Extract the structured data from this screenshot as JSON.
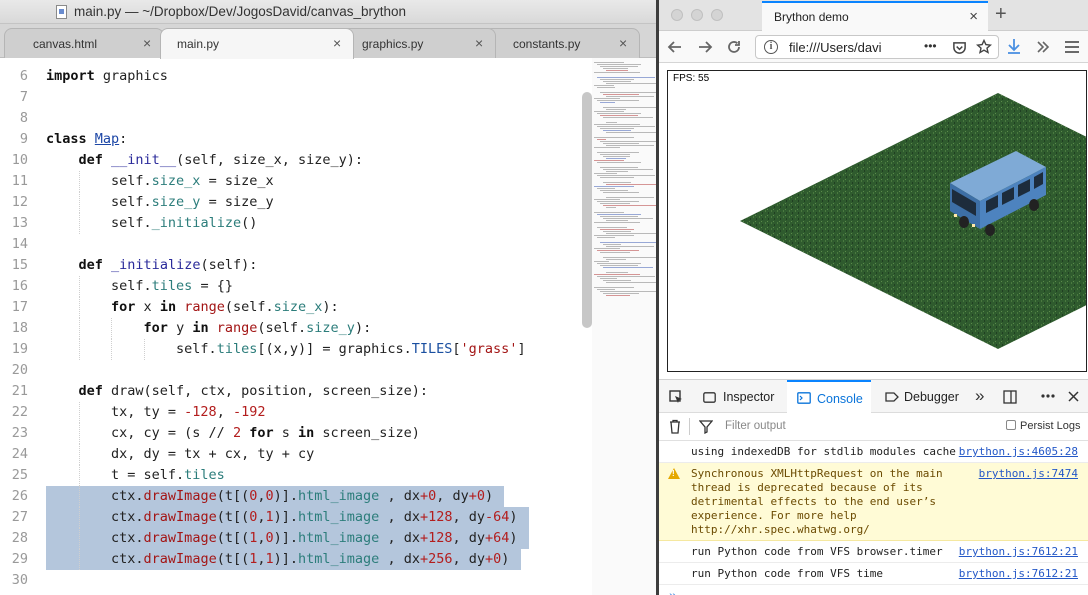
{
  "editor": {
    "window_title": "main.py — ~/Dropbox/Dev/JogosDavid/canvas_brython",
    "tabs": [
      {
        "label": "canvas.html",
        "active": false
      },
      {
        "label": "main.py",
        "active": true
      },
      {
        "label": "graphics.py",
        "active": false
      },
      {
        "label": "constants.py",
        "active": false
      }
    ],
    "tab_close_glyph": "×",
    "line_numbers": [
      "6",
      "7",
      "8",
      "9",
      "10",
      "11",
      "12",
      "13",
      "14",
      "15",
      "16",
      "17",
      "18",
      "19",
      "20",
      "21",
      "22",
      "23",
      "24",
      "25",
      "26",
      "27",
      "28",
      "29",
      "30"
    ],
    "selected_lines": [
      "26",
      "27",
      "28",
      "29"
    ],
    "code_lines": [
      "import graphics",
      "",
      "",
      "class Map:",
      "    def __init__(self, size_x, size_y):",
      "        self.size_x = size_x",
      "        self.size_y = size_y",
      "        self._initialize()",
      "",
      "    def _initialize(self):",
      "        self.tiles = {}",
      "        for x in range(self.size_x):",
      "            for y in range(self.size_y):",
      "                self.tiles[(x,y)] = graphics.TILES['grass']",
      "",
      "    def draw(self, ctx, position, screen_size):",
      "        tx, ty = -128, -192",
      "        cx, cy = (s // 2 for s in screen_size)",
      "        dx, dy = tx + cx, ty + cy",
      "        t = self.tiles",
      "        ctx.drawImage(t[(0,0)].html_image , dx+0, dy+0)",
      "        ctx.drawImage(t[(0,1)].html_image , dx+128, dy-64)",
      "        ctx.drawImage(t[(1,0)].html_image , dx+128, dy+64)",
      "        ctx.drawImage(t[(1,1)].html_image , dx+256, dy+0)",
      ""
    ],
    "colors": {
      "selection": "#b4c6dc",
      "keyword": "#111111",
      "function": "#2a2a9a",
      "attribute": "#2c7d7b",
      "string": "#a31515"
    }
  },
  "browser": {
    "tab_title": "Brython demo",
    "tab_close_glyph": "×",
    "new_tab_glyph": "+",
    "nav_icons": [
      "back-icon",
      "forward-icon",
      "reload-icon"
    ],
    "url": "file:///Users/davi",
    "page_actions_glyph": "•••",
    "toolbar_icons": [
      "pocket-icon",
      "bookmark-star-icon",
      "download-icon",
      "overflow-chevron-icon",
      "menu-icon"
    ],
    "fps_label": "FPS: 55",
    "accent": "#0a84ff"
  },
  "devtools": {
    "tabs": [
      {
        "label": "Inspector",
        "active": false
      },
      {
        "label": "Console",
        "active": true
      },
      {
        "label": "Debugger",
        "active": false
      }
    ],
    "more_glyph": "»",
    "filter_placeholder": "Filter output",
    "persist_logs_label": "Persist Logs",
    "persist_logs_checked": false,
    "messages": [
      {
        "level": "log",
        "text": "using indexedDB for stdlib modules cache",
        "source": "brython.js:4605:28"
      },
      {
        "level": "warn",
        "text": "Synchronous XMLHttpRequest on the main\nthread is deprecated because of its\ndetrimental effects to the end user’s\nexperience. For more help\nhttp://xhr.spec.whatwg.org/",
        "source": "brython.js:7474"
      },
      {
        "level": "log",
        "text": "run Python code from VFS browser.timer",
        "source": "brython.js:7612:21"
      },
      {
        "level": "log",
        "text": "run Python code from VFS time",
        "source": "brython.js:7612:21"
      }
    ],
    "input_prompt_glyph": "»"
  }
}
